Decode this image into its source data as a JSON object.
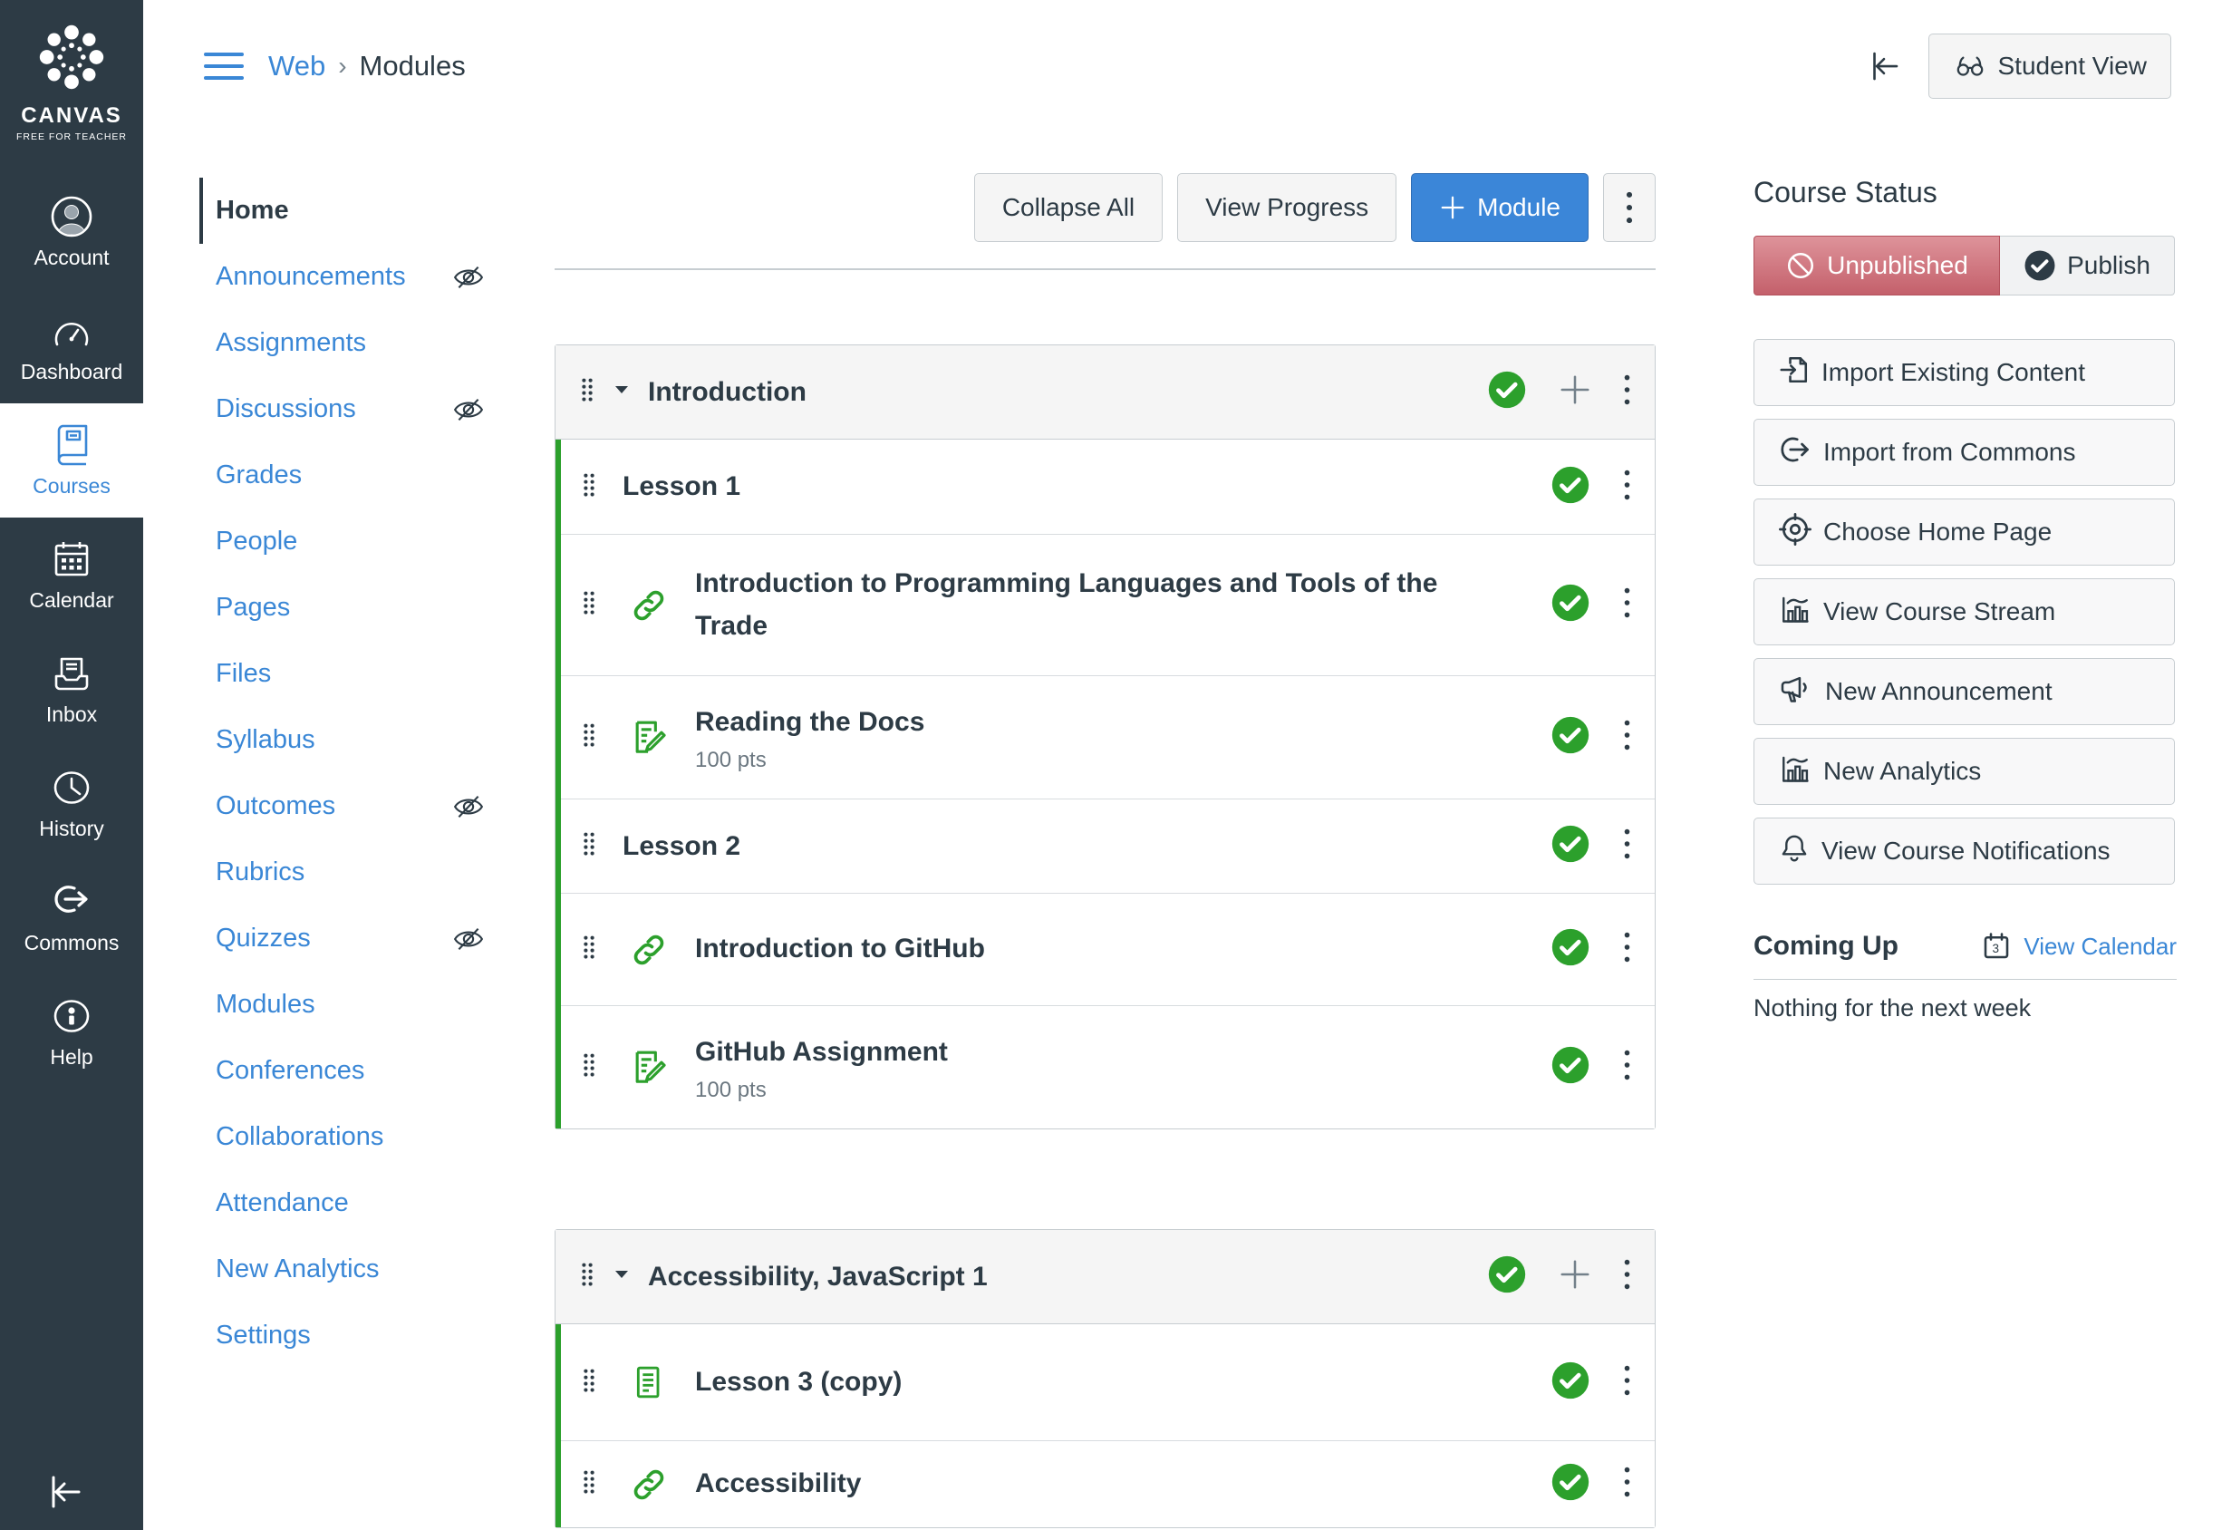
{
  "global_nav": {
    "logo_title": "CANVAS",
    "logo_subtitle": "FREE FOR TEACHER",
    "items": [
      {
        "id": "account",
        "label": "Account",
        "icon": "avatar-icon",
        "active": false
      },
      {
        "id": "dashboard",
        "label": "Dashboard",
        "icon": "dashboard-icon",
        "active": false
      },
      {
        "id": "courses",
        "label": "Courses",
        "icon": "courses-icon",
        "active": true
      },
      {
        "id": "calendar",
        "label": "Calendar",
        "icon": "calendar-icon",
        "active": false
      },
      {
        "id": "inbox",
        "label": "Inbox",
        "icon": "inbox-icon",
        "active": false
      },
      {
        "id": "history",
        "label": "History",
        "icon": "history-icon",
        "active": false
      },
      {
        "id": "commons",
        "label": "Commons",
        "icon": "commons-icon",
        "active": false
      },
      {
        "id": "help",
        "label": "Help",
        "icon": "help-icon",
        "active": false
      }
    ]
  },
  "header": {
    "breadcrumb": {
      "course": "Web",
      "separator": "›",
      "page": "Modules"
    },
    "student_view_label": "Student View"
  },
  "course_nav": {
    "items": [
      {
        "label": "Home",
        "active": true,
        "hidden": false
      },
      {
        "label": "Announcements",
        "active": false,
        "hidden": true
      },
      {
        "label": "Assignments",
        "active": false,
        "hidden": false
      },
      {
        "label": "Discussions",
        "active": false,
        "hidden": true
      },
      {
        "label": "Grades",
        "active": false,
        "hidden": false
      },
      {
        "label": "People",
        "active": false,
        "hidden": false
      },
      {
        "label": "Pages",
        "active": false,
        "hidden": false
      },
      {
        "label": "Files",
        "active": false,
        "hidden": false
      },
      {
        "label": "Syllabus",
        "active": false,
        "hidden": false
      },
      {
        "label": "Outcomes",
        "active": false,
        "hidden": true
      },
      {
        "label": "Rubrics",
        "active": false,
        "hidden": false
      },
      {
        "label": "Quizzes",
        "active": false,
        "hidden": true
      },
      {
        "label": "Modules",
        "active": false,
        "hidden": false
      },
      {
        "label": "Conferences",
        "active": false,
        "hidden": false
      },
      {
        "label": "Collaborations",
        "active": false,
        "hidden": false
      },
      {
        "label": "Attendance",
        "active": false,
        "hidden": false
      },
      {
        "label": "New Analytics",
        "active": false,
        "hidden": false
      },
      {
        "label": "Settings",
        "active": false,
        "hidden": false
      }
    ]
  },
  "toolbar": {
    "collapse_all": "Collapse All",
    "view_progress": "View Progress",
    "add_module": "Module"
  },
  "modules": [
    {
      "title": "Introduction",
      "published": true,
      "items": [
        {
          "type": "subheader",
          "title": "Lesson 1",
          "points": "",
          "published": true
        },
        {
          "type": "link",
          "title": "Introduction to Programming Languages and Tools of the Trade",
          "points": "",
          "published": true,
          "twoline": true
        },
        {
          "type": "assignment",
          "title": "Reading the Docs",
          "points": "100 pts",
          "published": true
        },
        {
          "type": "subheader",
          "title": "Lesson 2",
          "points": "",
          "published": true
        },
        {
          "type": "link",
          "title": "Introduction to GitHub",
          "points": "",
          "published": true
        },
        {
          "type": "assignment",
          "title": "GitHub Assignment",
          "points": "100 pts",
          "published": true
        }
      ]
    },
    {
      "title": "Accessibility, JavaScript 1",
      "published": true,
      "items": [
        {
          "type": "page",
          "title": "Lesson 3 (copy)",
          "points": "",
          "published": true
        },
        {
          "type": "link",
          "title": "Accessibility",
          "points": "",
          "published": true,
          "cut": true
        }
      ]
    }
  ],
  "course_status": {
    "heading": "Course Status",
    "unpublished_label": "Unpublished",
    "publish_label": "Publish"
  },
  "sidebar_actions": [
    {
      "label": "Import Existing Content",
      "icon": "import-content-icon"
    },
    {
      "label": "Import from Commons",
      "icon": "import-commons-icon"
    },
    {
      "label": "Choose Home Page",
      "icon": "target-icon"
    },
    {
      "label": "View Course Stream",
      "icon": "chart-icon"
    },
    {
      "label": "New Announcement",
      "icon": "megaphone-icon"
    },
    {
      "label": "New Analytics",
      "icon": "chart-icon"
    },
    {
      "label": "View Course Notifications",
      "icon": "bell-icon"
    }
  ],
  "coming_up": {
    "heading": "Coming Up",
    "view_calendar": "View Calendar",
    "empty_text": "Nothing for the next week"
  },
  "colors": {
    "nav_bg": "#2D3B45",
    "link_blue": "#3A87D6",
    "primary_blue": "#3B86D8",
    "published_green": "#2CA02C",
    "unpublished_pink": "#CE6B74"
  }
}
